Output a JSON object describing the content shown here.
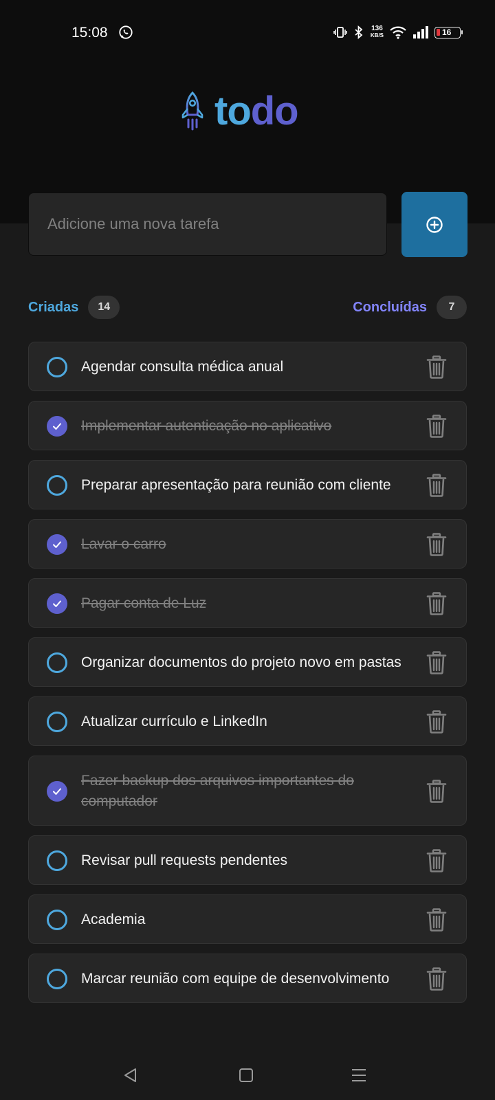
{
  "status_bar": {
    "time": "15:08",
    "net_speed_value": "136",
    "net_speed_unit": "KB/S",
    "battery_level": "16",
    "icons": [
      "whatsapp-icon",
      "vibrate-icon",
      "bluetooth-icon",
      "wifi-icon",
      "signal-icon",
      "battery-icon"
    ]
  },
  "header": {
    "logo_part1": "to",
    "logo_part2": "do",
    "logo_icon": "rocket-icon",
    "colors": {
      "to": "#4ea8de",
      "do": "#5e60ce"
    }
  },
  "new_task": {
    "placeholder": "Adicione uma nova tarefa",
    "value": "",
    "add_icon": "plus-circle-icon"
  },
  "counters": {
    "created_label": "Criadas",
    "created_count": "14",
    "done_label": "Concluídas",
    "done_count": "7"
  },
  "tasks": [
    {
      "text": "Agendar consulta médica anual",
      "done": false
    },
    {
      "text": "Implementar autenticação no aplicativo",
      "done": true
    },
    {
      "text": "Preparar apresentação para reunião com cliente",
      "done": false
    },
    {
      "text": "Lavar o carro",
      "done": true
    },
    {
      "text": "Pagar conta de Luz",
      "done": true
    },
    {
      "text": "Organizar documentos do projeto novo em pastas",
      "done": false
    },
    {
      "text": "Atualizar currículo e LinkedIn",
      "done": false
    },
    {
      "text": "Fazer backup dos arquivos importantes do computador",
      "done": true
    },
    {
      "text": "Revisar pull requests pendentes",
      "done": false
    },
    {
      "text": "Academia",
      "done": false
    },
    {
      "text": "Marcar reunião com equipe de desenvolvimento",
      "done": false
    }
  ],
  "nav_bar": {
    "icons": [
      "back-icon",
      "home-icon",
      "menu-icon"
    ]
  }
}
